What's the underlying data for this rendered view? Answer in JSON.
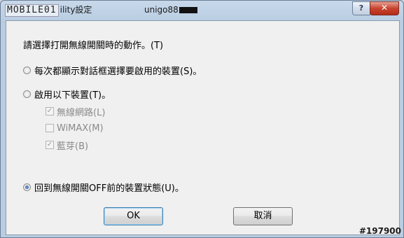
{
  "window": {
    "title_logo": "MOBILE01",
    "title_suffix": "ility設定",
    "title_user": "unigo88",
    "help_label": "?",
    "close_label": "✕"
  },
  "dialog": {
    "prompt": "請選擇打開無線開關時的動作。(T)",
    "options": [
      {
        "label": "每次都顯示對話框選擇要啟用的裝置(S)。",
        "checked": false
      },
      {
        "label": "啟用以下裝置(T)。",
        "checked": false
      },
      {
        "label": "回到無線開關OFF前的裝置狀態(U)。",
        "checked": true
      }
    ],
    "devices": [
      {
        "label": "無線網路(L)",
        "checked": true,
        "mark": "✓"
      },
      {
        "label": "WiMAX(M)",
        "checked": false,
        "mark": ""
      },
      {
        "label": "藍芽(B)",
        "checked": true,
        "mark": "✓"
      }
    ],
    "ok_label": "OK",
    "cancel_label": "取消"
  },
  "watermark": "#197900"
}
